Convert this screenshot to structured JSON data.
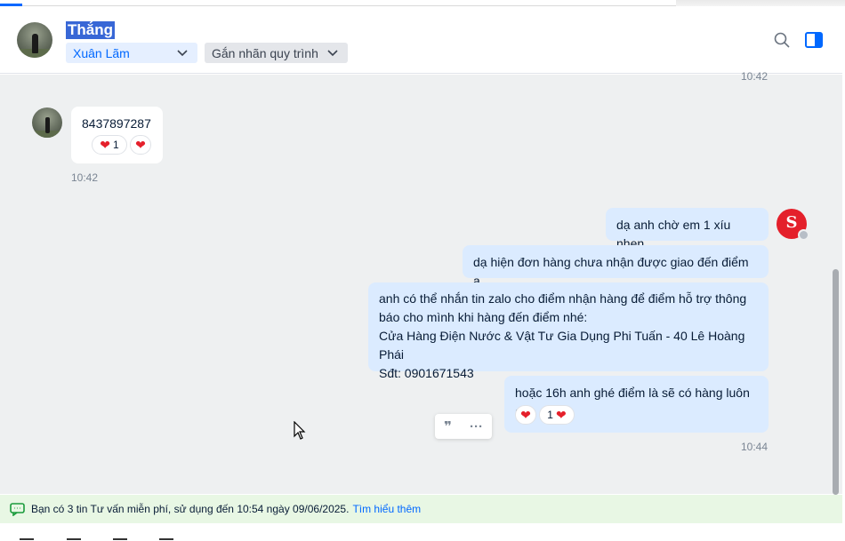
{
  "header": {
    "contact_name": "Thắng",
    "assignee": "Xuân Lãm",
    "tag_button": "Gắn nhãn quy trình"
  },
  "messages": {
    "top_timestamp": "10:42",
    "incoming": {
      "text": "8437897287",
      "reaction_count": "1",
      "timestamp": "10:42"
    },
    "outgoing": [
      {
        "text": "dạ anh chờ em 1 xíu nhen"
      },
      {
        "text": "dạ hiện đơn hàng chưa nhận được giao đến điểm ạ."
      },
      {
        "lines": [
          "anh có thể nhắn tin zalo cho điểm nhận hàng để điểm hỗ trợ thông",
          "báo cho mình khi hàng đến điểm nhé:",
          "Cửa Hàng Điện Nước & Vật Tư Gia Dụng Phi Tuấn - 40 Lê Hoàng Phái",
          "Sđt: 0901671543"
        ]
      },
      {
        "text": "hoặc 16h anh ghé điểm là sẽ có hàng luôn ạ",
        "reaction_count": "1"
      }
    ],
    "outgoing_timestamp": "10:44"
  },
  "notice": {
    "text": "Bạn có 3 tin Tư vấn miễn phí, sử dụng đến 10:54 ngày 09/06/2025.",
    "link": "Tìm hiểu thêm"
  },
  "icons": {
    "search": "search-icon",
    "panel": "panel-toggle-icon",
    "quote": "quote-icon",
    "more": "more-icon",
    "heart": "heart-icon",
    "chat_info": "chat-info-icon"
  },
  "colors": {
    "accent": "#0068ff",
    "outgoing_bubble": "#dbebff",
    "notice_bg": "#e8f7e4",
    "heart": "#e5202b"
  }
}
